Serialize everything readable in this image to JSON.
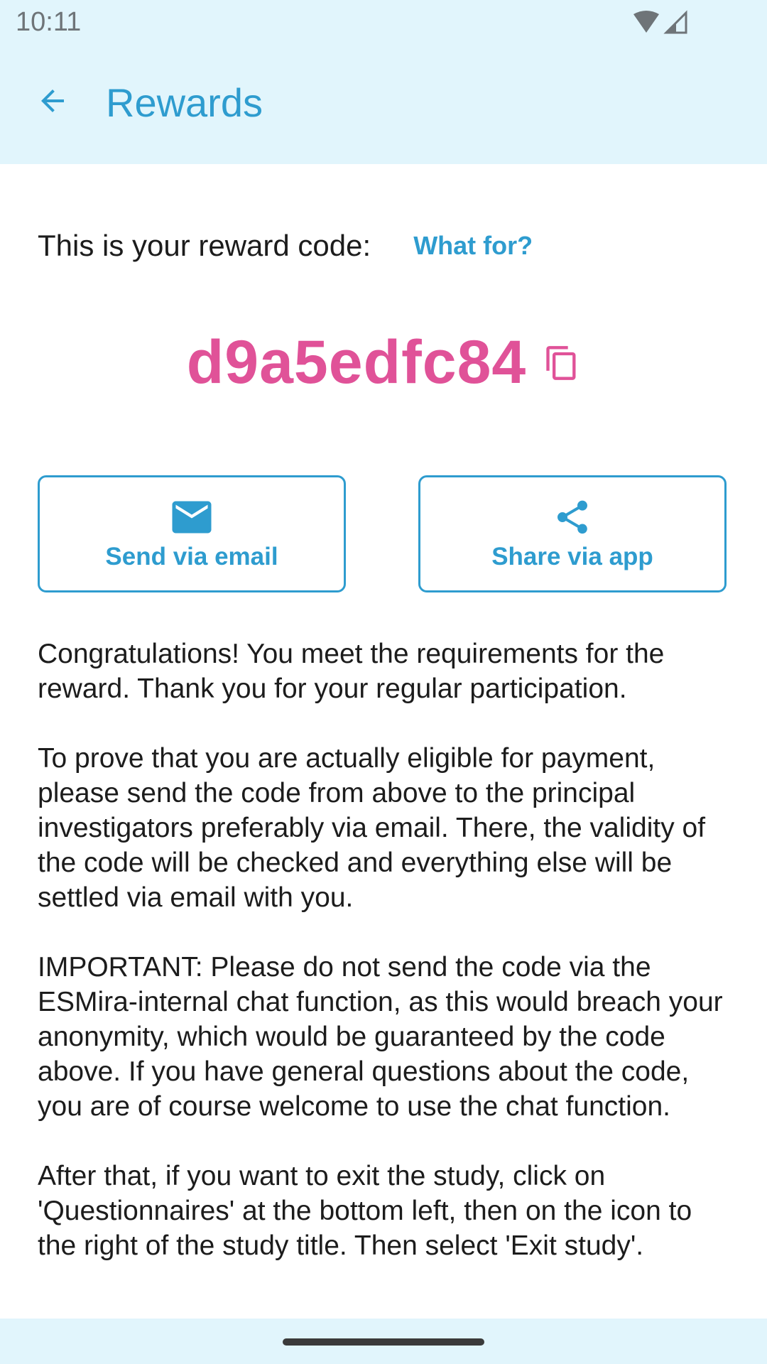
{
  "status_bar": {
    "time": "10:11"
  },
  "app_bar": {
    "title": "Rewards"
  },
  "reward": {
    "label": "This is your reward code:",
    "what_for": "What for?",
    "code": "d9a5edfc84"
  },
  "actions": {
    "email_label": "Send via email",
    "share_label": "Share via app"
  },
  "body": {
    "paragraphs": [
      "Congratulations! You meet the requirements for the reward. Thank you for your regular participation.",
      "To prove that you are actually eligible for payment, please send the code from above to the principal investigators preferably via email. There, the validity of the code will be checked and everything else will be settled via email with you.",
      "IMPORTANT: Please do not send the code via the ESMira-internal chat function, as this would breach your anonymity, which would be guaranteed by the code above. If you have general questions about the code, you are of course welcome to use the chat function.",
      "After that, if you want to exit the study, click on 'Questionnaires' at the bottom left, then on the icon to the right of the study title. Then select 'Exit study'."
    ]
  },
  "colors": {
    "accent": "#2e9ccf",
    "code": "#e05298",
    "bar_background": "#e1f5fc"
  },
  "icons": {
    "back": "arrow-back-icon",
    "copy": "copy-icon",
    "email": "email-icon",
    "share": "share-icon",
    "wifi": "wifi-icon",
    "signal": "signal-icon"
  }
}
